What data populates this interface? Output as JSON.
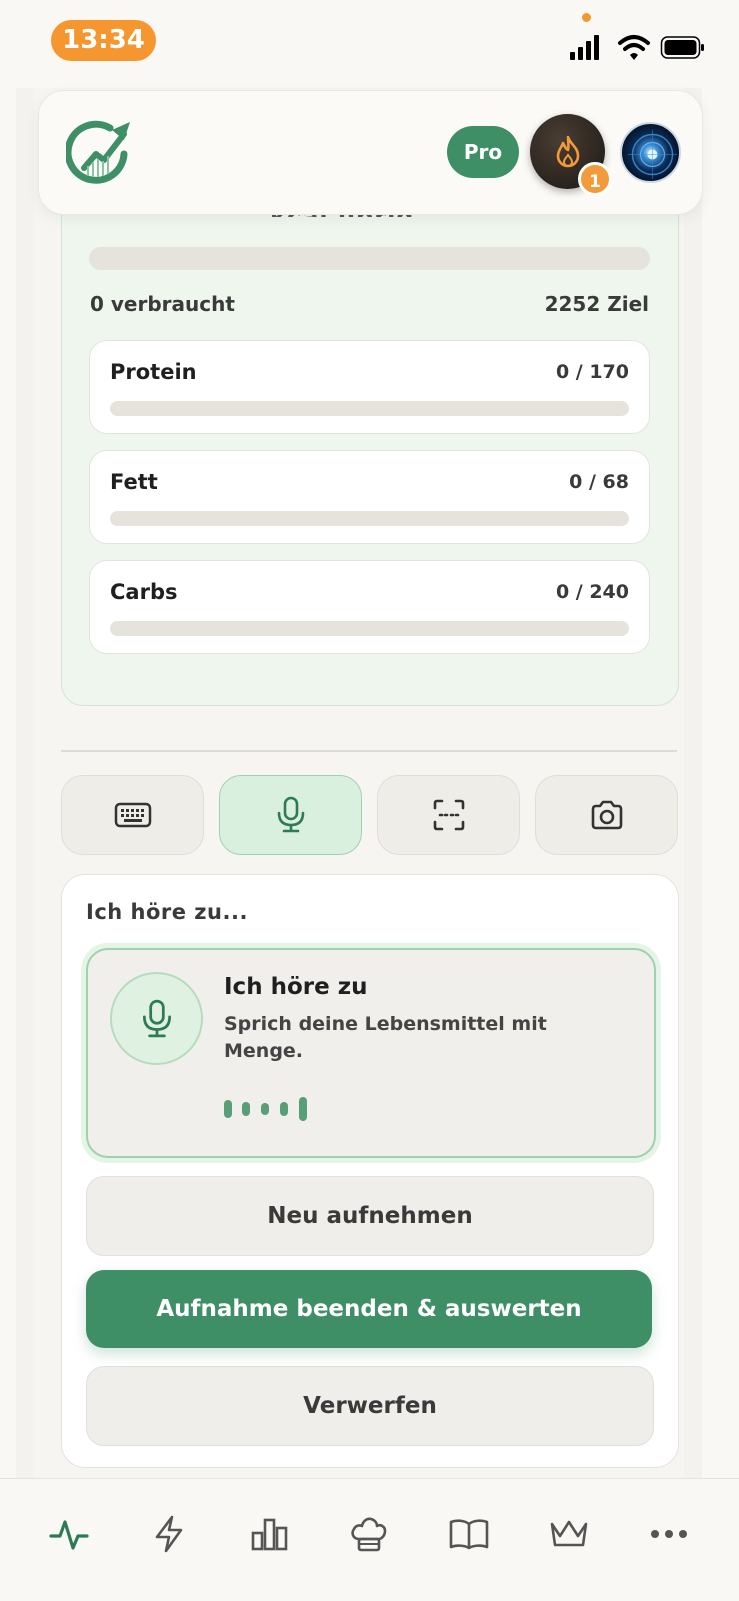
{
  "status_bar": {
    "time": "13:34"
  },
  "header": {
    "logo_icon": "trend-arrow-logo",
    "pro_label": "Pro",
    "streak_icon": "flame-icon",
    "streak_count": "1",
    "avatar_icon": "avatar"
  },
  "calories": {
    "peek_unit": "kcal übrig",
    "progress": 0,
    "consumed_label": "0 verbraucht",
    "goal_label": "2252 Ziel"
  },
  "macros": [
    {
      "name": "Protein",
      "value": "0 / 170",
      "progress": 0
    },
    {
      "name": "Fett",
      "value": "0 / 68",
      "progress": 0
    },
    {
      "name": "Carbs",
      "value": "0 / 240",
      "progress": 0
    }
  ],
  "input_modes": [
    {
      "icon": "keyboard-icon",
      "active": false
    },
    {
      "icon": "microphone-icon",
      "active": true
    },
    {
      "icon": "barcode-scan-icon",
      "active": false
    },
    {
      "icon": "camera-icon",
      "active": false
    }
  ],
  "voice": {
    "panel_title": "Ich höre zu...",
    "listening_title": "Ich höre zu",
    "listening_subtitle": "Sprich deine Lebensmittel mit Menge.",
    "rerecord_label": "Neu aufnehmen",
    "finish_label": "Aufnahme beenden & auswerten",
    "discard_label": "Verwerfen"
  },
  "bottom_nav": [
    {
      "icon": "activity-icon",
      "active": true
    },
    {
      "icon": "lightning-icon",
      "active": false
    },
    {
      "icon": "bar-chart-icon",
      "active": false
    },
    {
      "icon": "chef-hat-icon",
      "active": false
    },
    {
      "icon": "book-icon",
      "active": false
    },
    {
      "icon": "crown-icon",
      "active": false
    },
    {
      "icon": "more-icon",
      "active": false
    }
  ],
  "colors": {
    "accent": "#3f8f66",
    "streak_badge": "#f39a3a",
    "time_pill": "#f5962e"
  }
}
